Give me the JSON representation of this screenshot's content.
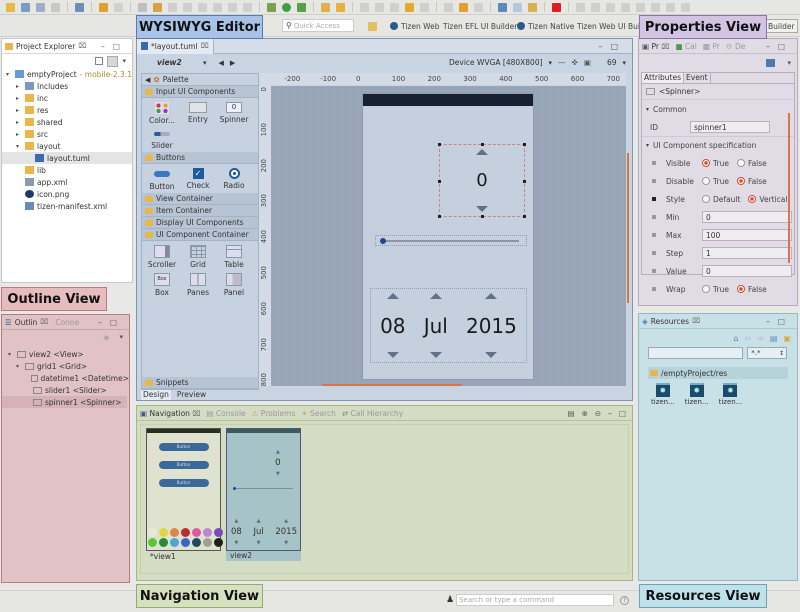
{
  "toolbar": {
    "quick_access_placeholder": "Quick Access",
    "perspectives": [
      "Tizen Web",
      "Tizen EFL UI Builder",
      "Tizen Native",
      "Tizen Web UI Builder"
    ],
    "perspective_right_tail": "Builder"
  },
  "labels": {
    "wysiwyg": "WYSIWYG Editor",
    "properties": "Properties View",
    "outline": "Outline View",
    "navigation": "Navigation View",
    "resources": "Resources View"
  },
  "project_explorer": {
    "title": "Project Explorer",
    "project_name": "emptyProject",
    "project_suffix": "- mobile-2.3.1",
    "items": [
      {
        "label": "Includes",
        "kind": "lib",
        "expand": "collapsed",
        "level": 1
      },
      {
        "label": "inc",
        "kind": "folder",
        "expand": "collapsed",
        "level": 1
      },
      {
        "label": "res",
        "kind": "folder",
        "expand": "collapsed",
        "level": 1
      },
      {
        "label": "shared",
        "kind": "folder",
        "expand": "collapsed",
        "level": 1
      },
      {
        "label": "src",
        "kind": "folder",
        "expand": "collapsed",
        "level": 1
      },
      {
        "label": "layout",
        "kind": "folder",
        "expand": "expanded",
        "level": 1
      },
      {
        "label": "layout.tuml",
        "kind": "file",
        "expand": "none",
        "level": 2,
        "selected": true
      },
      {
        "label": "lib",
        "kind": "folder",
        "expand": "none",
        "level": 1
      },
      {
        "label": "app.xml",
        "kind": "xml",
        "expand": "none",
        "level": 1
      },
      {
        "label": "icon.png",
        "kind": "png",
        "expand": "none",
        "level": 1
      },
      {
        "label": "tizen-manifest.xml",
        "kind": "manifest",
        "expand": "none",
        "level": 1
      }
    ]
  },
  "editor": {
    "tab": "*layout.tuml",
    "view_selector": "view2",
    "device": "Device WVGA [480X800]",
    "zoom": "69",
    "palette_title": "Palette",
    "ruler_h": [
      "-200",
      "-100",
      "0",
      "100",
      "200",
      "300",
      "400",
      "500",
      "600",
      "700"
    ],
    "ruler_v": [
      "0",
      "100",
      "200",
      "300",
      "400",
      "500",
      "600",
      "700",
      "800"
    ],
    "palette": {
      "input_title": "Input UI Components",
      "input_items": [
        "Color...",
        "Entry",
        "Spinner",
        "Slider"
      ],
      "buttons_title": "Buttons",
      "button_items": [
        "Button",
        "Check",
        "Radio"
      ],
      "collapsed_groups": [
        "View Container",
        "Item Container",
        "Display UI Components"
      ],
      "container_title": "UI Component Container",
      "container_items": [
        "Scroller",
        "Grid",
        "Table",
        "Box",
        "Panes",
        "Panel"
      ],
      "snippets": "Snippets"
    },
    "bottom_tabs": [
      "Design",
      "Preview"
    ],
    "device_content": {
      "spinner_value": "0",
      "slider_value": 0,
      "date_day": "08",
      "date_month": "Jul",
      "date_year": "2015"
    }
  },
  "properties": {
    "tabs": [
      "Pr",
      "Cal",
      "Pr",
      "De"
    ],
    "sub_tabs": [
      "Attributes",
      "Event"
    ],
    "element": "<Spinner>",
    "common_title": "Common",
    "id_label": "ID",
    "id_value": "spinner1",
    "spec_title": "UI Component specification",
    "rows": [
      {
        "label": "Visible",
        "type": "radio",
        "options": [
          "True",
          "False"
        ],
        "selected": "True"
      },
      {
        "label": "Disable",
        "type": "radio",
        "options": [
          "True",
          "False"
        ],
        "selected": "False"
      },
      {
        "label": "Style",
        "type": "radio",
        "options": [
          "Default",
          "Vertical"
        ],
        "selected": "Vertical"
      },
      {
        "label": "Min",
        "type": "text",
        "value": "0"
      },
      {
        "label": "Max",
        "type": "text",
        "value": "100"
      },
      {
        "label": "Step",
        "type": "text",
        "value": "1"
      },
      {
        "label": "Value",
        "type": "text",
        "value": "0"
      },
      {
        "label": "Wrap",
        "type": "radio",
        "options": [
          "True",
          "False"
        ],
        "selected": "False"
      }
    ]
  },
  "outline": {
    "tabs": [
      "Outlin",
      "Conne"
    ],
    "items": [
      {
        "label": "view2 <View>",
        "level": 0
      },
      {
        "label": "grid1 <Grid>",
        "level": 1
      },
      {
        "label": "datetime1 <Datetime>",
        "level": 2
      },
      {
        "label": "slider1 <Slider>",
        "level": 2
      },
      {
        "label": "spinner1 <Spinner>",
        "level": 2,
        "selected": true
      }
    ]
  },
  "navigation": {
    "tabs": [
      "Navigation",
      "Console",
      "Problems",
      "Search",
      "Call Hierarchy"
    ],
    "views": [
      {
        "name": "*view1",
        "buttons": [
          "Button",
          "Button",
          "Button"
        ]
      },
      {
        "name": "view2",
        "spinner": "0",
        "day": "08",
        "month": "Jul",
        "year": "2015"
      }
    ],
    "swatch_colors": [
      "#e6e8d8",
      "#e0d83a",
      "#e0844a",
      "#b82e2e",
      "#dc5aa0",
      "#b989d0",
      "#7a4cb8",
      "#5ec43a",
      "#2e8a32",
      "#4aa6d2",
      "#3a64c8",
      "#1e4a5e",
      "#a0a090",
      "#1e2414"
    ]
  },
  "resources": {
    "title": "Resources",
    "filter_value": "*.*",
    "path": "/emptyProject/res",
    "files": [
      "tizen...",
      "tizen...",
      "tizen..."
    ]
  },
  "status": {
    "command_placeholder": "Search or type a command"
  },
  "colors": {
    "wysiwyg": "#a9c3e8",
    "properties": "#d3c4e3",
    "outline": "#e7bcbf",
    "navigation": "#d6e1c0",
    "resources": "#bfe2ea",
    "accent_red": "#d24a2a"
  }
}
